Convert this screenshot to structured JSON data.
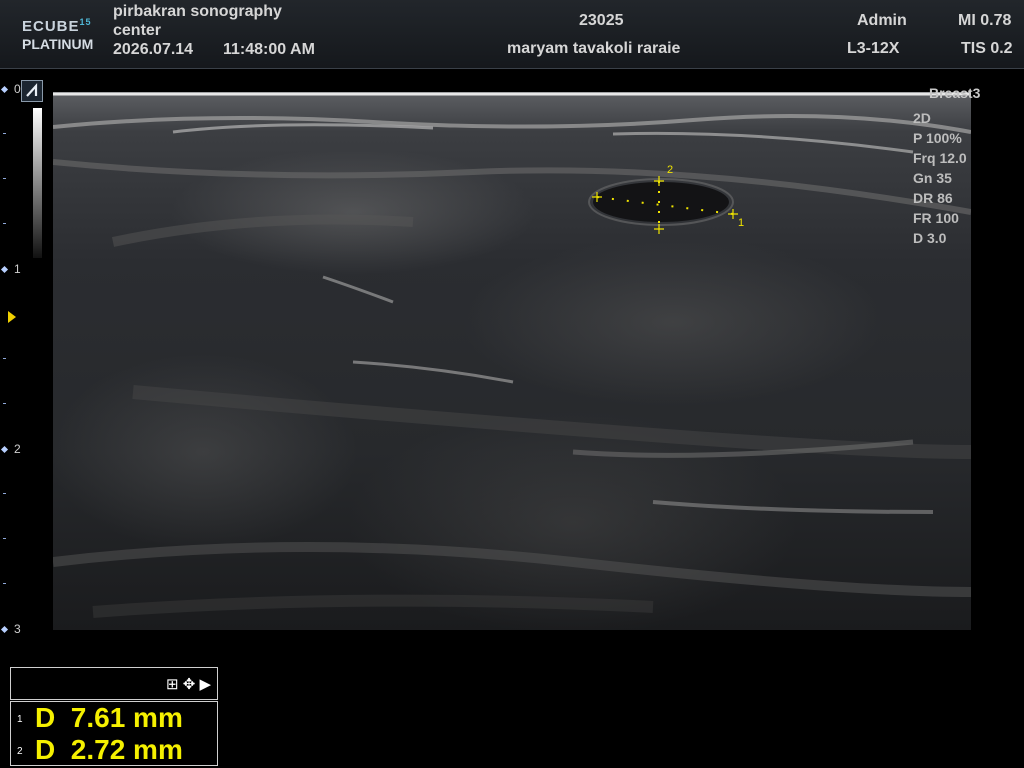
{
  "header": {
    "logo_line1": "ECUBE",
    "logo_sup": "15",
    "logo_line2": "PLATINUM",
    "institution_line1": "pirbakran sonography",
    "institution_line2": "center",
    "date": "2026.07.14",
    "time": "11:48:00  AM",
    "patient_id": "23025",
    "patient_name": "maryam tavakoli raraie",
    "operator": "Admin",
    "probe": "L3-12X",
    "mi": "MI 0.78",
    "tis": "TIS 0.2"
  },
  "depth_ruler": {
    "labels": [
      "0",
      "1",
      "2",
      "3"
    ]
  },
  "preset": "Breast3",
  "imaging_params": [
    "2D",
    "P 100%",
    "Frq 12.0",
    "Gn 35",
    "DR 86",
    "FR 100",
    "D 3.0"
  ],
  "calipers": {
    "label_1": "1",
    "label_2": "2"
  },
  "measurement_panel": {
    "icons": [
      "grid-icon",
      "move-icon",
      "expand-arrow-icon"
    ],
    "rows": [
      {
        "num": "1",
        "text": "D  7.61 mm"
      },
      {
        "num": "2",
        "text": "D  2.72 mm"
      }
    ]
  }
}
